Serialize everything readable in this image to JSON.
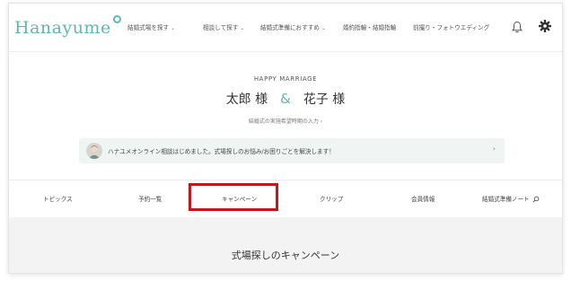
{
  "header": {
    "logo_text": "Hanayume",
    "nav": [
      {
        "label": "結婚式場を探す",
        "has_dropdown": true
      },
      {
        "label": "相談して探す",
        "has_dropdown": true
      },
      {
        "label": "結婚式準備におすすめ",
        "has_dropdown": true
      },
      {
        "label": "婚約指輪・結婚指輪",
        "has_dropdown": false
      },
      {
        "label": "前撮り・フォトウエディング",
        "has_dropdown": false
      }
    ],
    "icons": [
      "bell-icon",
      "gear-icon"
    ]
  },
  "profile": {
    "label": "HAPPY MARRIAGE",
    "groom": "太郎 様",
    "ampersand": "&",
    "bride": "花子 様",
    "date_link": "結婚式の実施希望時期の入力 ›"
  },
  "banner": {
    "text": "ハナユメオンライン相談はじめました。式場探しのお悩み/お困りごとを解決します！",
    "chevron": "›"
  },
  "tabs": [
    {
      "label": "トピックス"
    },
    {
      "label": "予約一覧"
    },
    {
      "label": "キャンペーン",
      "highlighted": true
    },
    {
      "label": "クリップ"
    },
    {
      "label": "会員情報"
    },
    {
      "label": "結婚式準備ノート"
    }
  ],
  "section": {
    "title": "式場探しのキャンペーン"
  },
  "colors": {
    "brand": "#5fb6b3",
    "highlight_border": "#c4161c",
    "banner_bg": "#eef5f3",
    "section_bg": "#f3f3f3"
  }
}
